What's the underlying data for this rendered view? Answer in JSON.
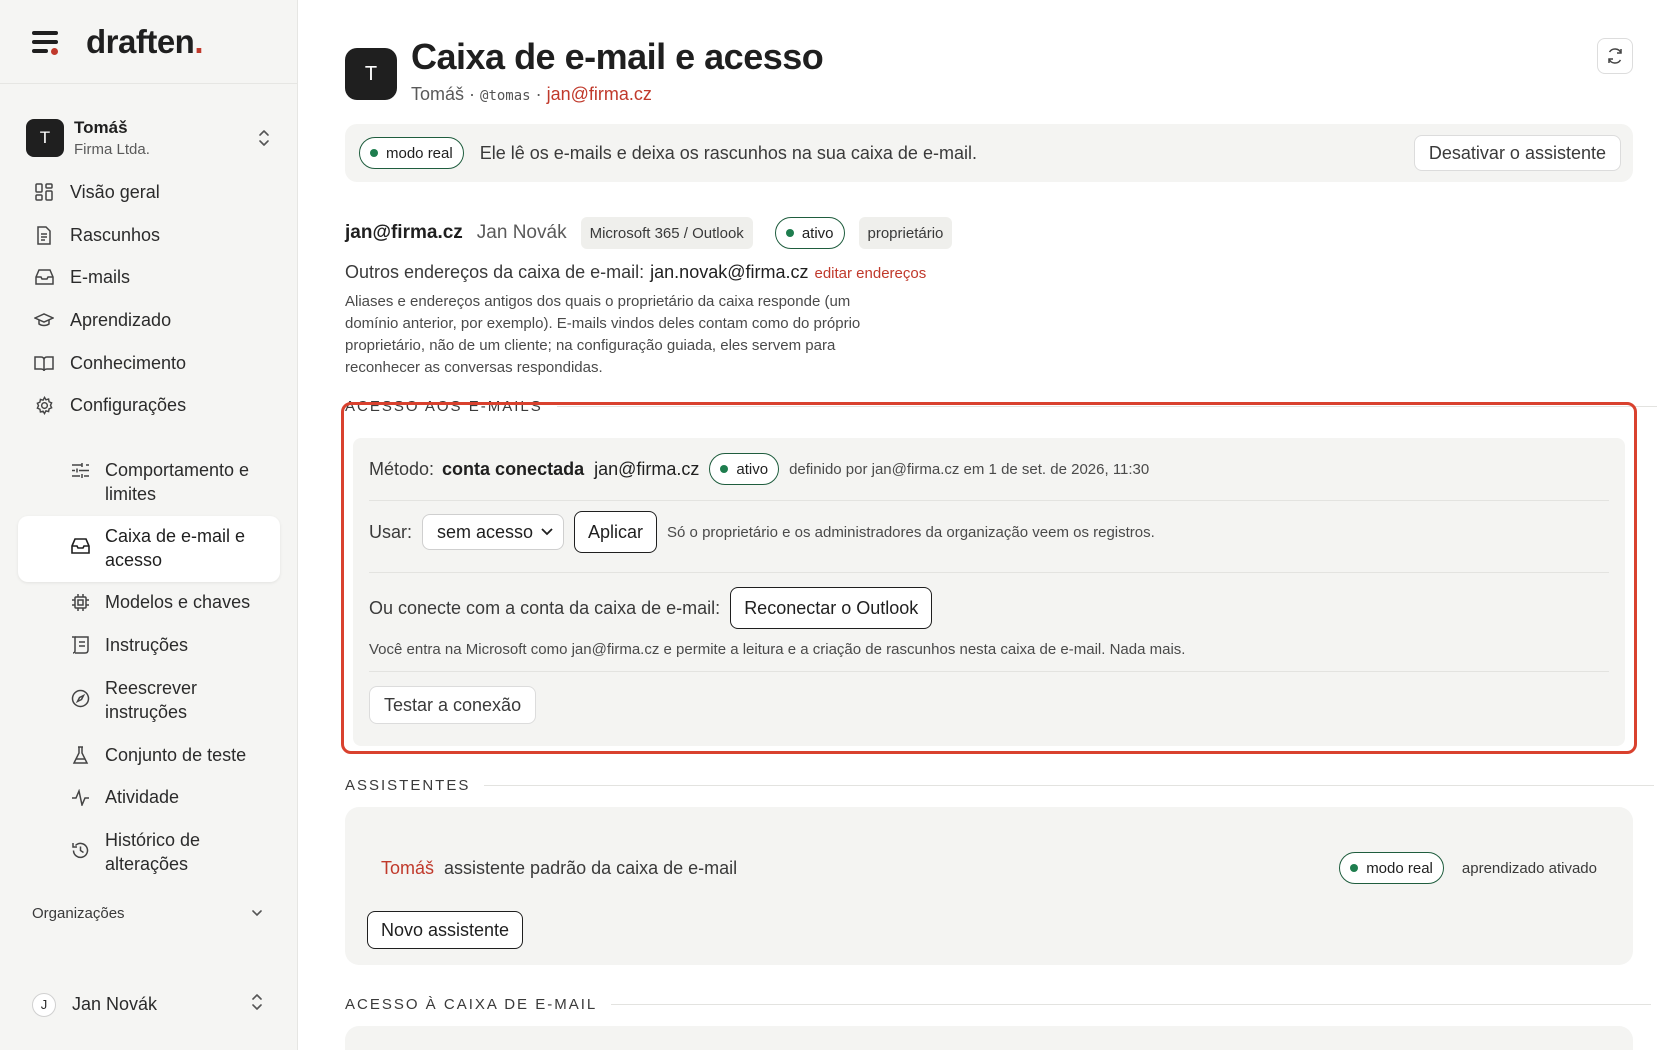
{
  "brand": {
    "name": "draften",
    "period": "."
  },
  "account": {
    "initial": "T",
    "name": "Tomáš",
    "org": "Firma Ltda."
  },
  "nav": [
    {
      "label": "Visão geral",
      "icon": "grid-icon"
    },
    {
      "label": "Rascunhos",
      "icon": "document-icon"
    },
    {
      "label": "E-mails",
      "icon": "inbox-icon"
    },
    {
      "label": "Aprendizado",
      "icon": "graduation-cap-icon"
    },
    {
      "label": "Conhecimento",
      "icon": "book-icon"
    },
    {
      "label": "Configurações",
      "icon": "gear-icon"
    }
  ],
  "subnav": [
    {
      "label": "Comportamento e limites",
      "icon": "sliders-icon"
    },
    {
      "label": "Caixa de e-mail e acesso",
      "icon": "inbox-icon",
      "active": true
    },
    {
      "label": "Modelos e chaves",
      "icon": "chip-icon"
    },
    {
      "label": "Instruções",
      "icon": "scroll-icon"
    },
    {
      "label": "Reescrever instruções",
      "icon": "compass-icon"
    },
    {
      "label": "Conjunto de teste",
      "icon": "flask-icon"
    },
    {
      "label": "Atividade",
      "icon": "activity-icon"
    },
    {
      "label": "Histórico de alterações",
      "icon": "history-icon"
    }
  ],
  "organizations_label": "Organizações",
  "user": {
    "initial": "J",
    "name": "Jan Novák"
  },
  "page": {
    "initial": "T",
    "title": "Caixa de e-mail e acesso",
    "owner": "Tomáš",
    "sep1": " · ",
    "handle": "@tomas",
    "sep2": " · ",
    "email": "jan@firma.cz"
  },
  "mode_bar": {
    "pill": "modo real",
    "text": "Ele lê os e-mails e deixa os rascunhos na sua caixa de e-mail.",
    "button": "Desativar o assistente"
  },
  "mailbox": {
    "email": "jan@firma.cz",
    "name": "Jan Novák",
    "provider": "Microsoft 365 / Outlook",
    "status": "ativo",
    "role": "proprietário",
    "other_label": "Outros endereços da caixa de e-mail:",
    "other_value": "jan.novak@firma.cz",
    "edit_link": "editar endereços",
    "description": "Aliases e endereços antigos dos quais o proprietário da caixa responde (um domínio anterior, por exemplo). E-mails vindos deles contam como do próprio proprietário, não de um cliente; na configuração guiada, eles servem para reconhecer as conversas respondidas."
  },
  "access": {
    "heading": "ACESSO AOS E-MAILS",
    "method_label": "Método:",
    "method_value": "conta conectada",
    "method_email": "jan@firma.cz",
    "method_status": "ativo",
    "method_meta": "definido por jan@firma.cz em 1 de set. de 2026, 11:30",
    "use_label": "Usar:",
    "use_selected": "sem acesso",
    "apply_button": "Aplicar",
    "use_note": "Só o proprietário e os administradores da organização veem os registros.",
    "connect_label": "Ou conecte com a conta da caixa de e-mail:",
    "reconnect_button": "Reconectar o Outlook",
    "connect_note": "Você entra na Microsoft como jan@firma.cz e permite a leitura e a criação de rascunhos nesta caixa de e-mail. Nada mais.",
    "test_button": "Testar a conexão"
  },
  "assistants": {
    "heading": "ASSISTENTES",
    "name": "Tomáš",
    "description": "assistente padrão da caixa de e-mail",
    "mode": "modo real",
    "learning": "aprendizado ativado",
    "new_button": "Novo assistente"
  },
  "mailbox_access_heading": "ACESSO À CAIXA DE E-MAIL",
  "colors": {
    "accent": "#c0392b",
    "active_green": "#1e7d4e",
    "highlight": "#d9412e"
  }
}
